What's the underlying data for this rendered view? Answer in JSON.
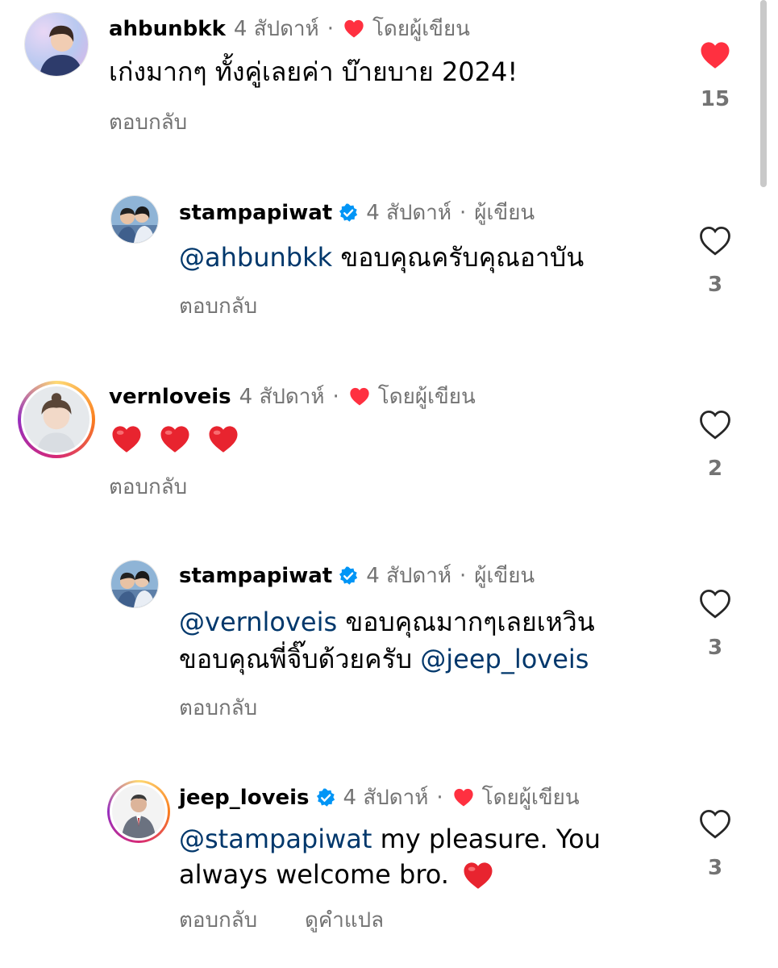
{
  "labels": {
    "reply": "ตอบกลับ",
    "translate": "ดูคำแปล",
    "author_liked": "โดยผู้เขียน",
    "author": "ผู้เขียน",
    "dot": "·"
  },
  "colors": {
    "heart_red": "#ff3040",
    "mention_blue": "#00376b",
    "muted_gray": "#737373",
    "verified_blue": "#0095f6"
  },
  "comments": [
    {
      "username": "ahbunbkk",
      "time": "4 สัปดาห์",
      "author_badge": "โดยผู้เขียน",
      "text": "เก่งมากๆ ทั้งคู่เลยค่า บ๊ายบาย 2024!",
      "likes": "15",
      "liked": true,
      "avatar_icon": "profile-photo"
    },
    {
      "username": "stampapiwat",
      "verified": true,
      "time": "4 สัปดาห์",
      "author_badge": "ผู้เขียน",
      "mention": "@ahbunbkk",
      "text": "ขอบคุณครับคุณอาบัน",
      "likes": "3",
      "liked": false,
      "avatar_icon": "profile-photo"
    },
    {
      "username": "vernloveis",
      "time": "4 สัปดาห์",
      "author_badge": "โดยผู้เขียน",
      "text_emoji": [
        "red-heart-emoji",
        "red-heart-emoji",
        "red-heart-emoji"
      ],
      "likes": "2",
      "liked": false,
      "avatar_icon": "profile-photo-story-ring"
    },
    {
      "username": "stampapiwat",
      "verified": true,
      "time": "4 สัปดาห์",
      "author_badge": "ผู้เขียน",
      "mention": "@vernloveis",
      "text": "ขอบคุณมากๆเลยเหวิน",
      "line2_text": "ขอบคุณพี่จิ๊บด้วยครับ",
      "line2_mention": "@jeep_loveis",
      "likes": "3",
      "liked": false,
      "avatar_icon": "profile-photo"
    },
    {
      "username": "jeep_loveis",
      "verified": true,
      "time": "4 สัปดาห์",
      "author_badge": "โดยผู้เขียน",
      "mention": "@stampapiwat",
      "text": "my pleasure. You",
      "line2_text": "always welcome bro.",
      "likes": "3",
      "liked": false,
      "avatar_icon": "profile-photo-story-ring"
    }
  ]
}
